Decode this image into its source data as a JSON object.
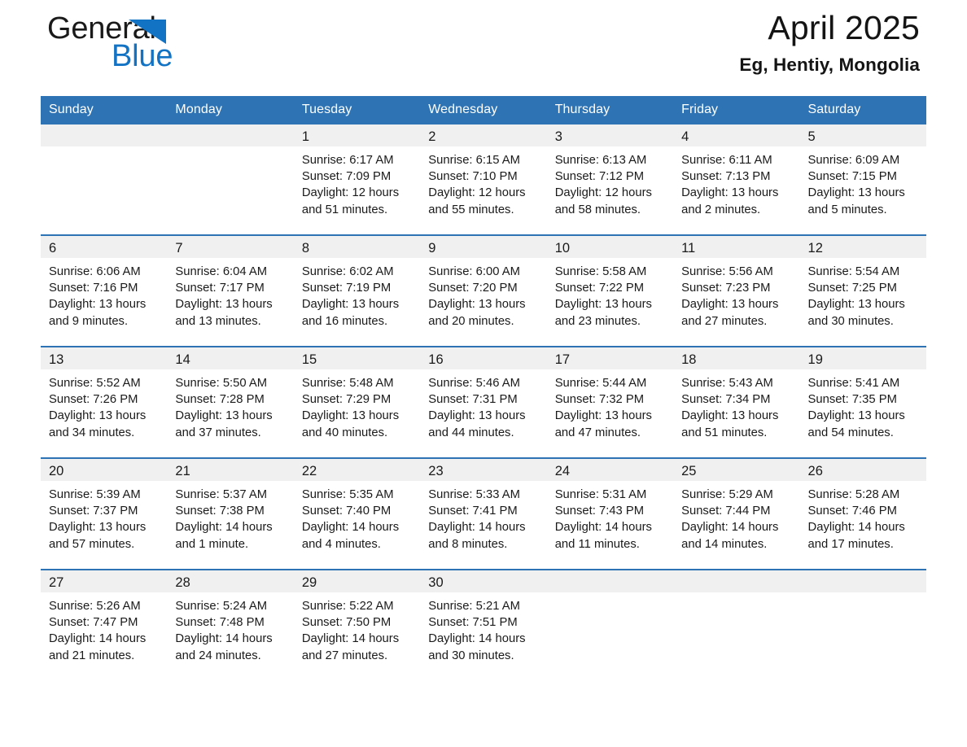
{
  "brand": {
    "name_part1": "General",
    "name_part2": "Blue",
    "triangle_icon": "triangle-logo-icon",
    "colors": {
      "blue": "#1273c4",
      "black": "#1a1a1a"
    }
  },
  "header": {
    "title": "April 2025",
    "subtitle": "Eg, Hentiy, Mongolia"
  },
  "theme": {
    "header_bg": "#2e74b5",
    "header_text": "#ffffff",
    "row_divider": "#2e74b5",
    "day_band_bg": "#f0f0f0",
    "page_bg": "#ffffff"
  },
  "calendar": {
    "weekday_headers": [
      "Sunday",
      "Monday",
      "Tuesday",
      "Wednesday",
      "Thursday",
      "Friday",
      "Saturday"
    ],
    "weeks": [
      [
        {
          "day": "",
          "sunrise": "",
          "sunset": "",
          "daylight_line1": "",
          "daylight_line2": ""
        },
        {
          "day": "",
          "sunrise": "",
          "sunset": "",
          "daylight_line1": "",
          "daylight_line2": ""
        },
        {
          "day": "1",
          "sunrise": "Sunrise: 6:17 AM",
          "sunset": "Sunset: 7:09 PM",
          "daylight_line1": "Daylight: 12 hours",
          "daylight_line2": "and 51 minutes."
        },
        {
          "day": "2",
          "sunrise": "Sunrise: 6:15 AM",
          "sunset": "Sunset: 7:10 PM",
          "daylight_line1": "Daylight: 12 hours",
          "daylight_line2": "and 55 minutes."
        },
        {
          "day": "3",
          "sunrise": "Sunrise: 6:13 AM",
          "sunset": "Sunset: 7:12 PM",
          "daylight_line1": "Daylight: 12 hours",
          "daylight_line2": "and 58 minutes."
        },
        {
          "day": "4",
          "sunrise": "Sunrise: 6:11 AM",
          "sunset": "Sunset: 7:13 PM",
          "daylight_line1": "Daylight: 13 hours",
          "daylight_line2": "and 2 minutes."
        },
        {
          "day": "5",
          "sunrise": "Sunrise: 6:09 AM",
          "sunset": "Sunset: 7:15 PM",
          "daylight_line1": "Daylight: 13 hours",
          "daylight_line2": "and 5 minutes."
        }
      ],
      [
        {
          "day": "6",
          "sunrise": "Sunrise: 6:06 AM",
          "sunset": "Sunset: 7:16 PM",
          "daylight_line1": "Daylight: 13 hours",
          "daylight_line2": "and 9 minutes."
        },
        {
          "day": "7",
          "sunrise": "Sunrise: 6:04 AM",
          "sunset": "Sunset: 7:17 PM",
          "daylight_line1": "Daylight: 13 hours",
          "daylight_line2": "and 13 minutes."
        },
        {
          "day": "8",
          "sunrise": "Sunrise: 6:02 AM",
          "sunset": "Sunset: 7:19 PM",
          "daylight_line1": "Daylight: 13 hours",
          "daylight_line2": "and 16 minutes."
        },
        {
          "day": "9",
          "sunrise": "Sunrise: 6:00 AM",
          "sunset": "Sunset: 7:20 PM",
          "daylight_line1": "Daylight: 13 hours",
          "daylight_line2": "and 20 minutes."
        },
        {
          "day": "10",
          "sunrise": "Sunrise: 5:58 AM",
          "sunset": "Sunset: 7:22 PM",
          "daylight_line1": "Daylight: 13 hours",
          "daylight_line2": "and 23 minutes."
        },
        {
          "day": "11",
          "sunrise": "Sunrise: 5:56 AM",
          "sunset": "Sunset: 7:23 PM",
          "daylight_line1": "Daylight: 13 hours",
          "daylight_line2": "and 27 minutes."
        },
        {
          "day": "12",
          "sunrise": "Sunrise: 5:54 AM",
          "sunset": "Sunset: 7:25 PM",
          "daylight_line1": "Daylight: 13 hours",
          "daylight_line2": "and 30 minutes."
        }
      ],
      [
        {
          "day": "13",
          "sunrise": "Sunrise: 5:52 AM",
          "sunset": "Sunset: 7:26 PM",
          "daylight_line1": "Daylight: 13 hours",
          "daylight_line2": "and 34 minutes."
        },
        {
          "day": "14",
          "sunrise": "Sunrise: 5:50 AM",
          "sunset": "Sunset: 7:28 PM",
          "daylight_line1": "Daylight: 13 hours",
          "daylight_line2": "and 37 minutes."
        },
        {
          "day": "15",
          "sunrise": "Sunrise: 5:48 AM",
          "sunset": "Sunset: 7:29 PM",
          "daylight_line1": "Daylight: 13 hours",
          "daylight_line2": "and 40 minutes."
        },
        {
          "day": "16",
          "sunrise": "Sunrise: 5:46 AM",
          "sunset": "Sunset: 7:31 PM",
          "daylight_line1": "Daylight: 13 hours",
          "daylight_line2": "and 44 minutes."
        },
        {
          "day": "17",
          "sunrise": "Sunrise: 5:44 AM",
          "sunset": "Sunset: 7:32 PM",
          "daylight_line1": "Daylight: 13 hours",
          "daylight_line2": "and 47 minutes."
        },
        {
          "day": "18",
          "sunrise": "Sunrise: 5:43 AM",
          "sunset": "Sunset: 7:34 PM",
          "daylight_line1": "Daylight: 13 hours",
          "daylight_line2": "and 51 minutes."
        },
        {
          "day": "19",
          "sunrise": "Sunrise: 5:41 AM",
          "sunset": "Sunset: 7:35 PM",
          "daylight_line1": "Daylight: 13 hours",
          "daylight_line2": "and 54 minutes."
        }
      ],
      [
        {
          "day": "20",
          "sunrise": "Sunrise: 5:39 AM",
          "sunset": "Sunset: 7:37 PM",
          "daylight_line1": "Daylight: 13 hours",
          "daylight_line2": "and 57 minutes."
        },
        {
          "day": "21",
          "sunrise": "Sunrise: 5:37 AM",
          "sunset": "Sunset: 7:38 PM",
          "daylight_line1": "Daylight: 14 hours",
          "daylight_line2": "and 1 minute."
        },
        {
          "day": "22",
          "sunrise": "Sunrise: 5:35 AM",
          "sunset": "Sunset: 7:40 PM",
          "daylight_line1": "Daylight: 14 hours",
          "daylight_line2": "and 4 minutes."
        },
        {
          "day": "23",
          "sunrise": "Sunrise: 5:33 AM",
          "sunset": "Sunset: 7:41 PM",
          "daylight_line1": "Daylight: 14 hours",
          "daylight_line2": "and 8 minutes."
        },
        {
          "day": "24",
          "sunrise": "Sunrise: 5:31 AM",
          "sunset": "Sunset: 7:43 PM",
          "daylight_line1": "Daylight: 14 hours",
          "daylight_line2": "and 11 minutes."
        },
        {
          "day": "25",
          "sunrise": "Sunrise: 5:29 AM",
          "sunset": "Sunset: 7:44 PM",
          "daylight_line1": "Daylight: 14 hours",
          "daylight_line2": "and 14 minutes."
        },
        {
          "day": "26",
          "sunrise": "Sunrise: 5:28 AM",
          "sunset": "Sunset: 7:46 PM",
          "daylight_line1": "Daylight: 14 hours",
          "daylight_line2": "and 17 minutes."
        }
      ],
      [
        {
          "day": "27",
          "sunrise": "Sunrise: 5:26 AM",
          "sunset": "Sunset: 7:47 PM",
          "daylight_line1": "Daylight: 14 hours",
          "daylight_line2": "and 21 minutes."
        },
        {
          "day": "28",
          "sunrise": "Sunrise: 5:24 AM",
          "sunset": "Sunset: 7:48 PM",
          "daylight_line1": "Daylight: 14 hours",
          "daylight_line2": "and 24 minutes."
        },
        {
          "day": "29",
          "sunrise": "Sunrise: 5:22 AM",
          "sunset": "Sunset: 7:50 PM",
          "daylight_line1": "Daylight: 14 hours",
          "daylight_line2": "and 27 minutes."
        },
        {
          "day": "30",
          "sunrise": "Sunrise: 5:21 AM",
          "sunset": "Sunset: 7:51 PM",
          "daylight_line1": "Daylight: 14 hours",
          "daylight_line2": "and 30 minutes."
        },
        {
          "day": "",
          "sunrise": "",
          "sunset": "",
          "daylight_line1": "",
          "daylight_line2": ""
        },
        {
          "day": "",
          "sunrise": "",
          "sunset": "",
          "daylight_line1": "",
          "daylight_line2": ""
        },
        {
          "day": "",
          "sunrise": "",
          "sunset": "",
          "daylight_line1": "",
          "daylight_line2": ""
        }
      ]
    ]
  }
}
